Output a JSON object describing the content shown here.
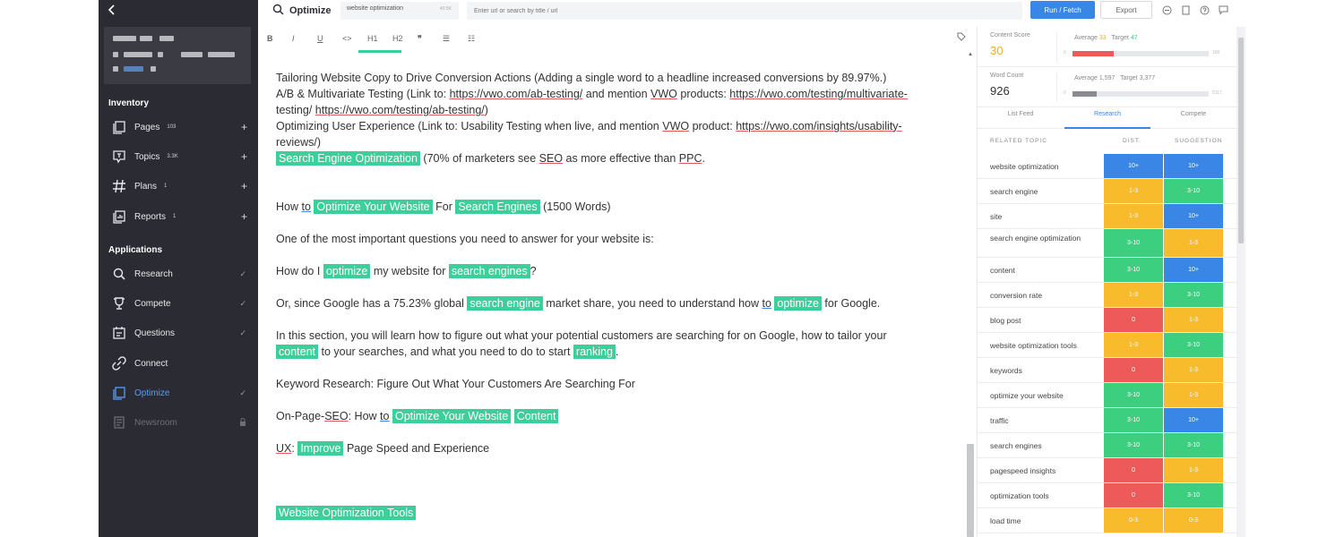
{
  "sidebar": {
    "sections": {
      "inventory": "Inventory",
      "applications": "Applications"
    },
    "inventory_items": [
      {
        "label": "Pages",
        "count": "103",
        "icon": "pages-icon"
      },
      {
        "label": "Topics",
        "count": "3.3K",
        "icon": "topics-icon"
      },
      {
        "label": "Plans",
        "count": "1",
        "icon": "hash-icon"
      },
      {
        "label": "Reports",
        "count": "1",
        "icon": "reports-icon"
      }
    ],
    "app_items": [
      {
        "label": "Research",
        "icon": "research-icon"
      },
      {
        "label": "Compete",
        "icon": "trophy-icon"
      },
      {
        "label": "Questions",
        "icon": "questions-icon"
      },
      {
        "label": "Connect",
        "icon": "link-icon"
      },
      {
        "label": "Optimize",
        "icon": "optimize-icon"
      },
      {
        "label": "Newsroom",
        "icon": "newsroom-icon"
      }
    ]
  },
  "topbar": {
    "title": "Optimize",
    "keyword": "website optimization",
    "keyword_count": "40.5K",
    "url_placeholder": "Enter url or search by title / url",
    "run_label": "Run / Fetch",
    "export_label": "Export"
  },
  "editor": {
    "lines": [
      "Tailoring Website Copy to Drive Conversion Actions (Adding a single word to a headline increased conversions by 89.97%.)"
    ],
    "ab_line_a": "A/B & Multivariate Testing (Link to: ",
    "ab_link1": "https://vwo.com/ab-testing/",
    "ab_mid": " and mention ",
    "ab_vwo": "VWO",
    "ab_products": " products: ",
    "ab_link2": "https://vwo.com/testing/multivariate-",
    "ab_line_b1": "testing/",
    "ab_link3": "https://vwo.com/testing/ab-testing/",
    "ab_line_b2": ")",
    "ux_line_a": "Optimizing User Experience (Link to: Usability Testing when live, and mention ",
    "ux_vwo": "VWO",
    "ux_product": " product: ",
    "ux_link": "https://vwo.com/insights/usability-",
    "ux_line_b": "reviews/)",
    "seo_hl": "Search Engine Optimization",
    "seo_rest_a": " (70% of marketers see ",
    "seo_abbr": "SEO",
    "seo_rest_b": " as more effective than ",
    "ppc": "PPC",
    "seo_rest_c": ".",
    "h_a": "How ",
    "h_to": "to",
    "h_hl1": "Optimize   Your Website",
    "h_for": " For ",
    "h_hl2": "Search Engines",
    "h_rest": " (1500 Words)",
    "q_line": "One of the most important questions you need to answer for your website is:",
    "hd_a": "How do I ",
    "hd_hl1": "optimize",
    "hd_b": " my website for ",
    "hd_hl2": "search engines",
    "hd_c": "?",
    "or_a": "Or, since Google has a 75.23% global ",
    "or_hl1": "search engine",
    "or_b": " market share, you need to understand how ",
    "or_to": "to",
    "or_hl2": "optimize",
    "or_c": " for Google.",
    "in_a": "In this section, you will learn how to figure out what your potential customers are searching for on Google, how to tailor your",
    "in_hl1": "content",
    "in_b": " to your searches, and what you need to do to start ",
    "in_hl2": "ranking",
    "in_c": ".",
    "kr_line": "Keyword Research: Figure Out What Your Customers Are Searching For",
    "op_a": "On-Page-",
    "op_seo": "SEO",
    "op_b": ": How ",
    "op_to": "to",
    "op_hl1": "Optimize   Your Website",
    "op_hl2": "Content",
    "ux2_a": "UX",
    "ux2_b": ": ",
    "ux2_hl": "Improve",
    "ux2_c": " Page Speed and Experience",
    "tools_hl": "Website   Optimization Tools"
  },
  "panel": {
    "content_score": {
      "label": "Content Score",
      "value": "30",
      "average_label": "Average",
      "average": "33",
      "target_label": "Target",
      "target": "47",
      "min": "0",
      "max": "100",
      "fill_pct": 0.3
    },
    "word_count": {
      "label": "Word Count",
      "value": "926",
      "average_label": "Average",
      "average": "1,597",
      "target_label": "Target",
      "target": "3,377",
      "min": "0",
      "max": "5117",
      "fill_pct": 0.18
    },
    "tabs": [
      "List Feed",
      "Research",
      "Compete"
    ],
    "headers": {
      "topic": "RELATED TOPIC",
      "dist": "DIST.",
      "suggestion": "SUGGESTION"
    },
    "colors": {
      "blue": "#3a86e6",
      "green": "#3ccf7f",
      "yellow": "#f7bb2c",
      "red": "#ee5a5a"
    },
    "rows": [
      {
        "topic": "website optimization",
        "dist": "10+",
        "dist_color": "blue",
        "sugg": "10+",
        "sugg_color": "blue"
      },
      {
        "topic": "search engine",
        "dist": "1-3",
        "dist_color": "yellow",
        "sugg": "3-10",
        "sugg_color": "green"
      },
      {
        "topic": "site",
        "dist": "1-3",
        "dist_color": "yellow",
        "sugg": "10+",
        "sugg_color": "blue"
      },
      {
        "topic": "search engine optimization",
        "dist": "3-10",
        "dist_color": "green",
        "sugg": "1-3",
        "sugg_color": "yellow"
      },
      {
        "topic": "content",
        "dist": "3-10",
        "dist_color": "green",
        "sugg": "10+",
        "sugg_color": "blue"
      },
      {
        "topic": "conversion rate",
        "dist": "1-3",
        "dist_color": "yellow",
        "sugg": "3-10",
        "sugg_color": "green"
      },
      {
        "topic": "blog post",
        "dist": "0",
        "dist_color": "red",
        "sugg": "1-3",
        "sugg_color": "yellow"
      },
      {
        "topic": "website optimization tools",
        "dist": "1-3",
        "dist_color": "yellow",
        "sugg": "3-10",
        "sugg_color": "green"
      },
      {
        "topic": "keywords",
        "dist": "0",
        "dist_color": "red",
        "sugg": "1-3",
        "sugg_color": "yellow"
      },
      {
        "topic": "optimize your website",
        "dist": "3-10",
        "dist_color": "green",
        "sugg": "1-3",
        "sugg_color": "yellow"
      },
      {
        "topic": "traffic",
        "dist": "3-10",
        "dist_color": "green",
        "sugg": "10+",
        "sugg_color": "blue"
      },
      {
        "topic": "search engines",
        "dist": "3-10",
        "dist_color": "green",
        "sugg": "3-10",
        "sugg_color": "green"
      },
      {
        "topic": "pagespeed insights",
        "dist": "0",
        "dist_color": "red",
        "sugg": "1-3",
        "sugg_color": "yellow"
      },
      {
        "topic": "optimization tools",
        "dist": "0",
        "dist_color": "red",
        "sugg": "3-10",
        "sugg_color": "green"
      },
      {
        "topic": "load time",
        "dist": "0-3",
        "dist_color": "yellow",
        "sugg": "0-3",
        "sugg_color": "yellow"
      }
    ]
  }
}
